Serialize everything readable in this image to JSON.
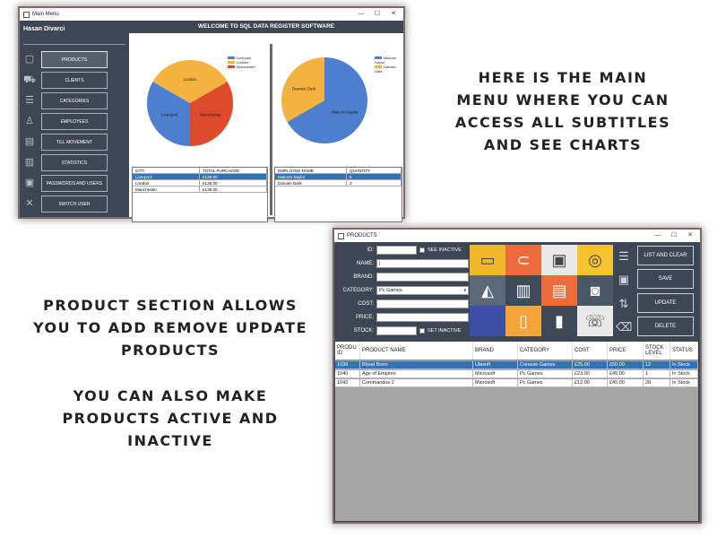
{
  "main_window": {
    "title": "Main Menu",
    "user": "Hasan Divarci",
    "header": "WELCOME TO SQL DATA REGISTER SOFTWARE",
    "nav": [
      {
        "label": "PRODUCTS",
        "icon": "box-icon"
      },
      {
        "label": "CLIENTS",
        "icon": "truck-icon"
      },
      {
        "label": "CATEGORIES",
        "icon": "list-icon"
      },
      {
        "label": "EMPLOYEES",
        "icon": "employee-icon"
      },
      {
        "label": "TILL MOVEMENT",
        "icon": "till-icon"
      },
      {
        "label": "STATISTICS",
        "icon": "stats-icon"
      },
      {
        "label": "PASSWORDS AND USERS",
        "icon": "lock-icon"
      },
      {
        "label": "SWITCH USER",
        "icon": "switch-user-icon"
      }
    ],
    "city_grid": {
      "headers": [
        "CITY",
        "TOTAL PURCHASE"
      ],
      "rows": [
        [
          "Liverpool",
          "£135.00"
        ],
        [
          "London",
          "£135.00"
        ],
        [
          "Manchester",
          "£135.00"
        ]
      ]
    },
    "employee_grid": {
      "headers": [
        "EMPLOYEE NAME",
        "QUANTITY"
      ],
      "rows": [
        [
          "Malcom Saylor",
          "6"
        ],
        [
          "Damien Dark",
          "3"
        ]
      ]
    }
  },
  "chart_data": [
    {
      "type": "pie",
      "title": "",
      "legend_position": "top-right",
      "categories": [
        "Liverpool",
        "London",
        "Manchester"
      ],
      "values": [
        1,
        1,
        1
      ],
      "colors": [
        "#4e7fce",
        "#f4b23e",
        "#de4a2c"
      ]
    },
    {
      "type": "pie",
      "title": "",
      "legend_position": "top-right",
      "categories": [
        "Malcom Saylor",
        "Damien Dark"
      ],
      "values": [
        6,
        3
      ],
      "colors": [
        "#4e7fce",
        "#f4b23e"
      ]
    }
  ],
  "products_window": {
    "title": "PRODUCTS",
    "labels": {
      "id": "ID:",
      "name": "NAME:",
      "brand": "BRAND:",
      "category": "CATEGORY:",
      "cost": "COST:",
      "price": "PRICE:",
      "stock": "STOCK:"
    },
    "see_inactive": "SEE INACTIVE",
    "set_inactive": "SET INACTIVE",
    "category_value": "Pc Games",
    "buttons": {
      "list_and_clear": "LIST AND CLEAR",
      "save": "SAVE",
      "update": "UPDATE",
      "delete": "DELETE"
    },
    "tiles": [
      {
        "icon": "tv-icon",
        "color": "#f2b82d",
        "glyph": "▭"
      },
      {
        "icon": "vacuum-icon",
        "color": "#ee6b3b",
        "glyph": "⊂"
      },
      {
        "icon": "oven-icon",
        "color": "#e9e9e9",
        "glyph": "▣"
      },
      {
        "icon": "washing-machine-icon",
        "color": "#f4c430",
        "glyph": "◎"
      },
      {
        "icon": "iron-icon",
        "color": "#5a6877",
        "glyph": "◭"
      },
      {
        "icon": "speaker-icon",
        "color": "#3d4a5a",
        "glyph": "▥"
      },
      {
        "icon": "microwave-icon",
        "color": "#ee6b3b",
        "glyph": "▤"
      },
      {
        "icon": "camera-icon",
        "color": "#4a5866",
        "glyph": "◙"
      },
      {
        "icon": "blank-tile-icon",
        "color": "#3a4fa5",
        "glyph": ""
      },
      {
        "icon": "kettle-icon",
        "color": "#f6a33a",
        "glyph": "▯"
      },
      {
        "icon": "usb-drive-icon",
        "color": "#3e4958",
        "glyph": "▮"
      },
      {
        "icon": "phone-icon",
        "color": "#e9e9e9",
        "glyph": "☏"
      }
    ],
    "table": {
      "headers": [
        "PRODU ID",
        "PRODUCT NAME",
        "BRAND",
        "CATEGORY",
        "COST",
        "PRICE",
        "STOCK LEVEL",
        "STATUS"
      ],
      "rows": [
        [
          "1039",
          "Blood Borm",
          "Ubisoft",
          "Console Games",
          "£25.00",
          "£50.00",
          "12",
          "In Stock"
        ],
        [
          "1040",
          "Age of Empires",
          "Microsoft",
          "Pc Games",
          "£23.00",
          "£45.00",
          "1",
          "In Stock"
        ],
        [
          "1043",
          "Commandos 2",
          "Microsoft",
          "Pc Games",
          "£12.00",
          "£45.00",
          "28",
          "In Stock"
        ]
      ]
    }
  },
  "captions": {
    "main": [
      "HERE IS THE MAIN",
      "MENU WHERE YOU CAN",
      "ACCESS ALL SUBTITLES",
      "AND SEE CHARTS"
    ],
    "product": [
      "PRODUCT SECTION ALLOWS",
      "YOU TO ADD REMOVE UPDATE",
      "PRODUCTS"
    ],
    "inactive": [
      "YOU CAN ALSO MAKE",
      "PRODUCTS ACTIVE AND",
      "INACTIVE"
    ]
  }
}
